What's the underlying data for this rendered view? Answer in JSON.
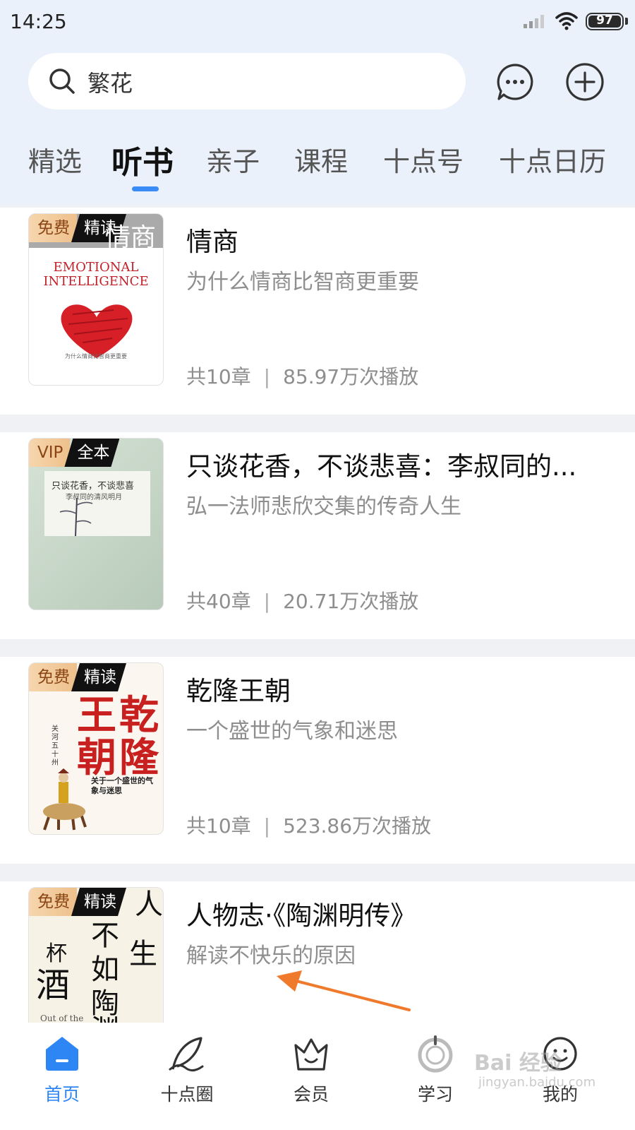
{
  "status_bar": {
    "time": "14:25",
    "battery": "97"
  },
  "search": {
    "query": "繁花"
  },
  "tabs": [
    {
      "label": "精选"
    },
    {
      "label": "听书"
    },
    {
      "label": "亲子"
    },
    {
      "label": "课程"
    },
    {
      "label": "十点号"
    },
    {
      "label": "十点日历"
    }
  ],
  "active_tab": "听书",
  "books": [
    {
      "title": "情商",
      "subtitle": "为什么情商比智商更重要",
      "chapters": "共10章",
      "plays": "85.97万次播放",
      "badge_left": "免费",
      "badge_right": "精读",
      "cover_text": {
        "header": "情商",
        "english": "EMOTIONAL INTELLIGENCE",
        "sub": "为什么情商比智商更重要"
      }
    },
    {
      "title": "只谈花香，不谈悲喜：李叔同的...",
      "subtitle": "弘一法师悲欣交集的传奇人生",
      "chapters": "共40章",
      "plays": "20.71万次播放",
      "badge_left": "VIP",
      "badge_right": "全本",
      "cover_text": {
        "title": "只谈花香，不谈悲喜",
        "sub": "李叔同的清风明月"
      }
    },
    {
      "title": "乾隆王朝",
      "subtitle": "一个盛世的气象和迷思",
      "chapters": "共10章",
      "plays": "523.86万次播放",
      "badge_left": "免费",
      "badge_right": "精读",
      "cover_text": {
        "c1": "乾",
        "c2": "隆",
        "c3": "王",
        "c4": "朝",
        "author": "关河五十州",
        "tagline": "关于一个盛世的气象与迷思"
      }
    },
    {
      "title": "人物志·《陶渊明传》",
      "subtitle": "解读不快乐的原因",
      "badge_left": "免费",
      "badge_right": "精读",
      "cover_text": {
        "c1": "人",
        "c2": "生",
        "c3": "不",
        "c4": "如",
        "c5": "陶",
        "c6": "渊",
        "c7": "杯",
        "c8": "酒",
        "english": "Out of the"
      }
    }
  ],
  "bottom_nav": [
    {
      "label": "首页",
      "icon": "home-icon"
    },
    {
      "label": "十点圈",
      "icon": "feather-icon"
    },
    {
      "label": "会员",
      "icon": "crown-icon"
    },
    {
      "label": "学习",
      "icon": "study-icon"
    },
    {
      "label": "我的",
      "icon": "profile-icon"
    }
  ],
  "watermark": {
    "main": "Bai 经验",
    "sub": "jingyan.baidu.com"
  },
  "colors": {
    "accent": "#2d86f3",
    "header_bg": "#eaf1fb",
    "badge_gold": "#eec08b",
    "arrow": "#f07a2c"
  }
}
